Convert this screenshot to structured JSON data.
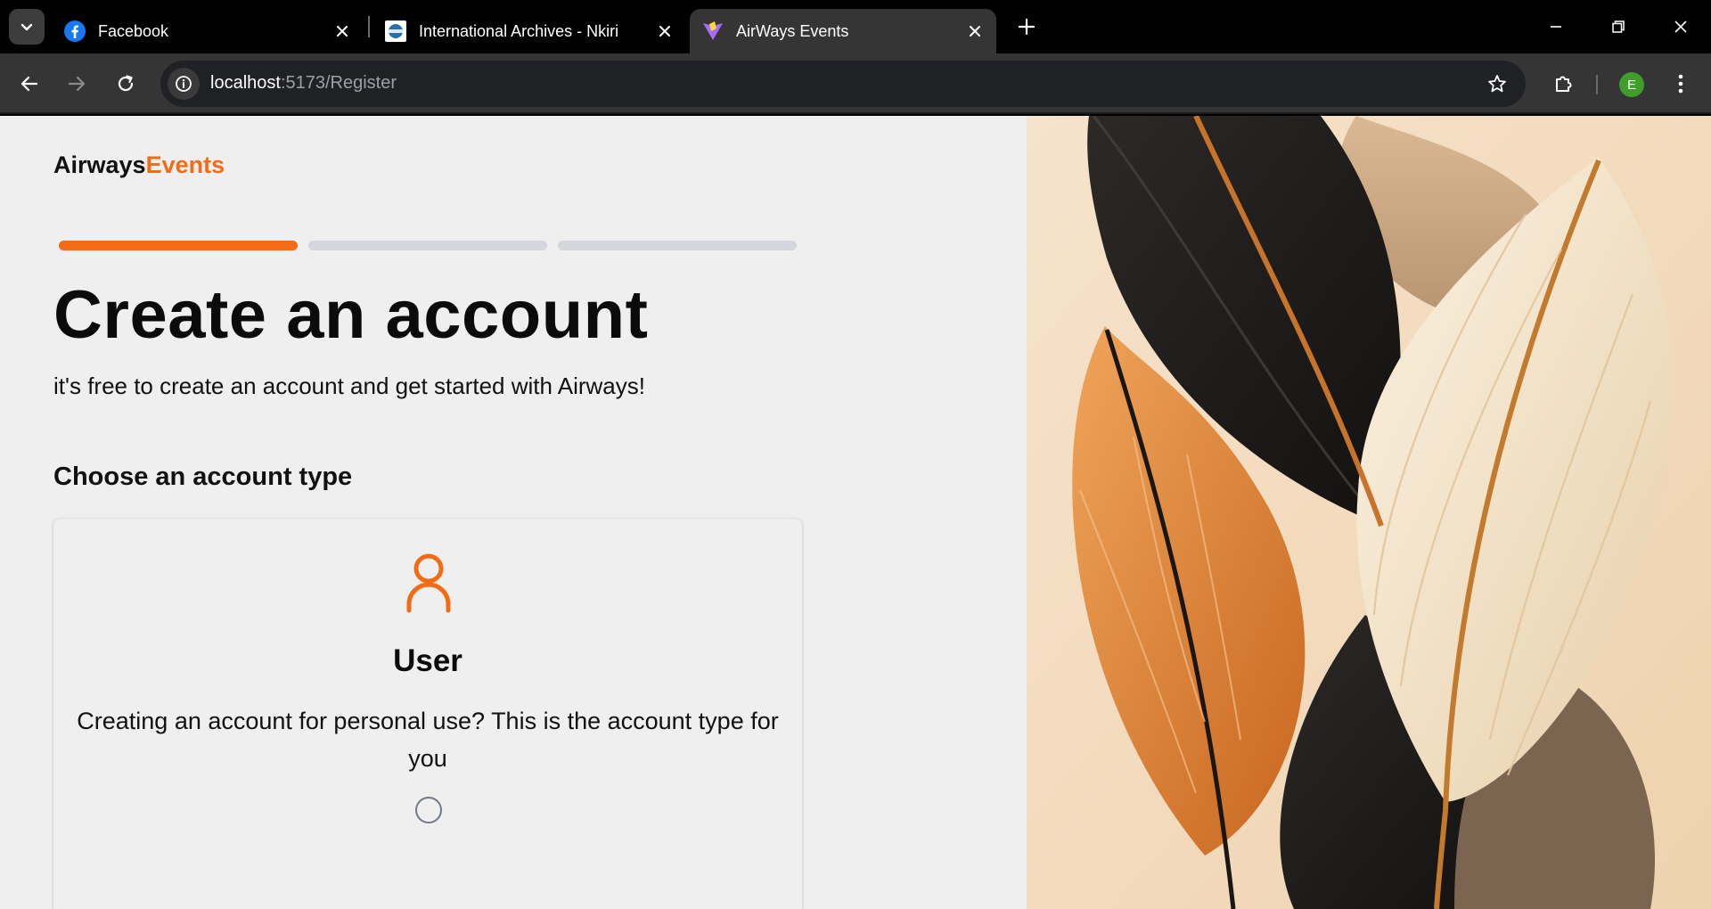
{
  "browser": {
    "tabs": [
      {
        "title": "Facebook",
        "icon": "facebook-icon"
      },
      {
        "title": "International Archives - Nkiri",
        "icon": "nkiri-icon"
      },
      {
        "title": "AirWays Events",
        "icon": "vite-icon"
      }
    ],
    "active_tab_index": 2,
    "url_host": "localhost",
    "url_rest": ":5173/Register",
    "profile_initial": "E",
    "colors": {
      "chrome_bg": "#000000",
      "toolbar_bg": "#353535",
      "profile": "#3f9d2b"
    }
  },
  "page": {
    "brand_primary": "Airways",
    "brand_accent": "Events",
    "progress": {
      "steps": 3,
      "current": 1
    },
    "heading": "Create an account",
    "subheading": "it's free to create an account and get started with Airways!",
    "choose_label": "Choose an account type",
    "card": {
      "icon": "user-icon",
      "title": "User",
      "description": "Creating an account for personal use? This is the account type for you",
      "selected": false
    },
    "colors": {
      "accent": "#f26b16",
      "background": "#efefef",
      "progress_inactive": "#d3d6dc"
    }
  }
}
